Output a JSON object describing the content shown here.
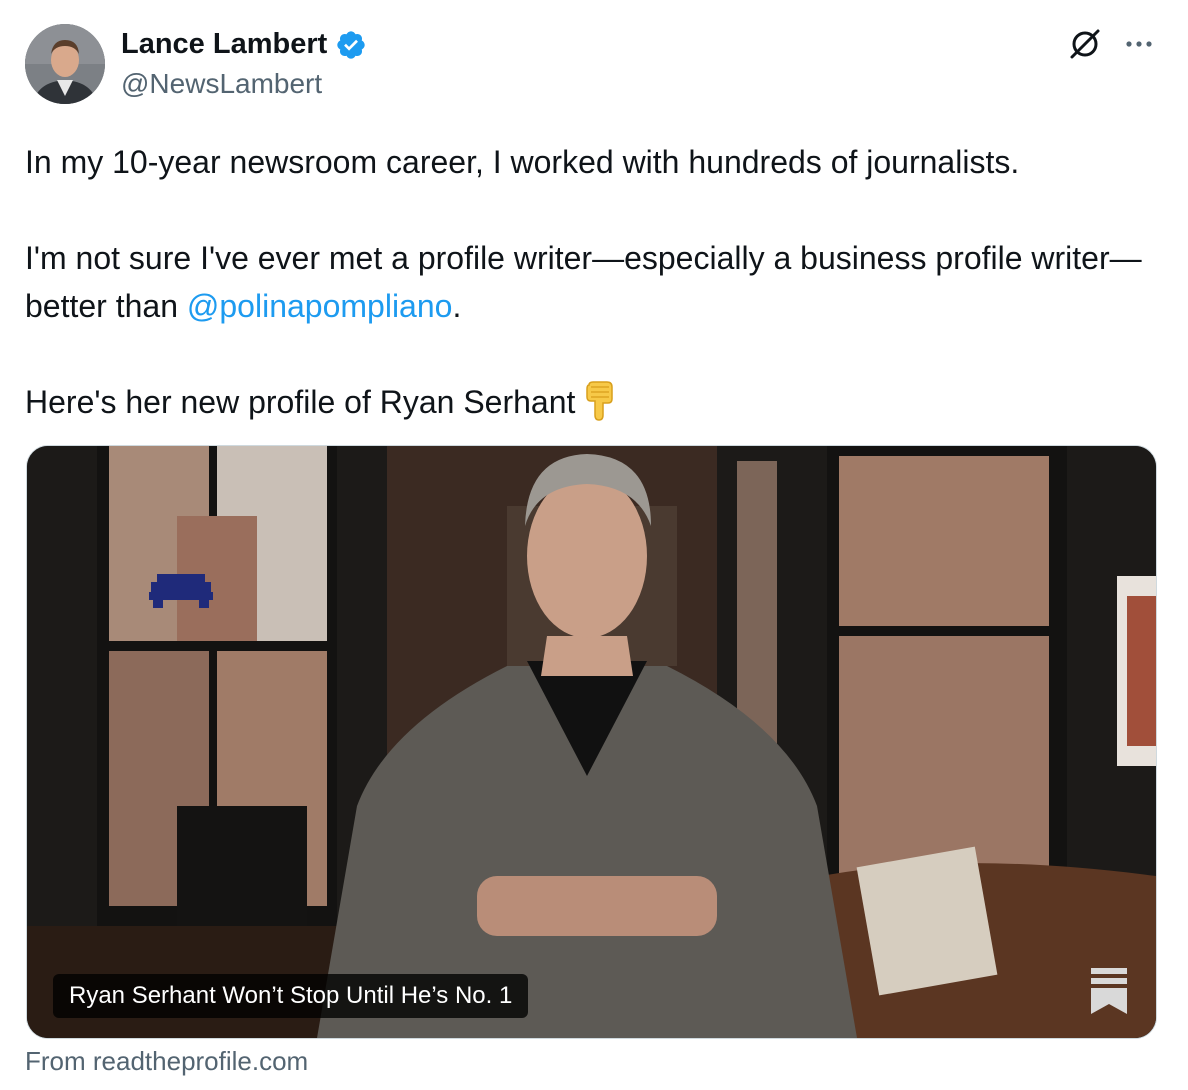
{
  "author": {
    "name": "Lance Lambert",
    "handle": "@NewsLambert",
    "verified_color": "#1d9bf0"
  },
  "icons": {
    "avatar": "avatar",
    "verified": "verified-badge-icon",
    "grok": "grok-icon",
    "more": "more-options-icon",
    "emoji": "backhand-index-pointing-down-emoji",
    "bookmark": "bookmark-icon"
  },
  "tweet": {
    "paragraph1": "In my 10-year newsroom career, I worked with hundreds of journalists.",
    "paragraph2_before": "I'm not sure I've ever met a profile writer—especially a business profile writer—better than ",
    "mention": "@polinapompliano",
    "paragraph2_after": ".",
    "paragraph3": "Here's her new profile of Ryan Serhant"
  },
  "card": {
    "title": "Ryan Serhant Won’t Stop Until He’s No. 1",
    "source": "From readtheprofile.com"
  },
  "colors": {
    "text": "#0f1419",
    "secondary": "#536471",
    "link": "#1d9bf0"
  }
}
